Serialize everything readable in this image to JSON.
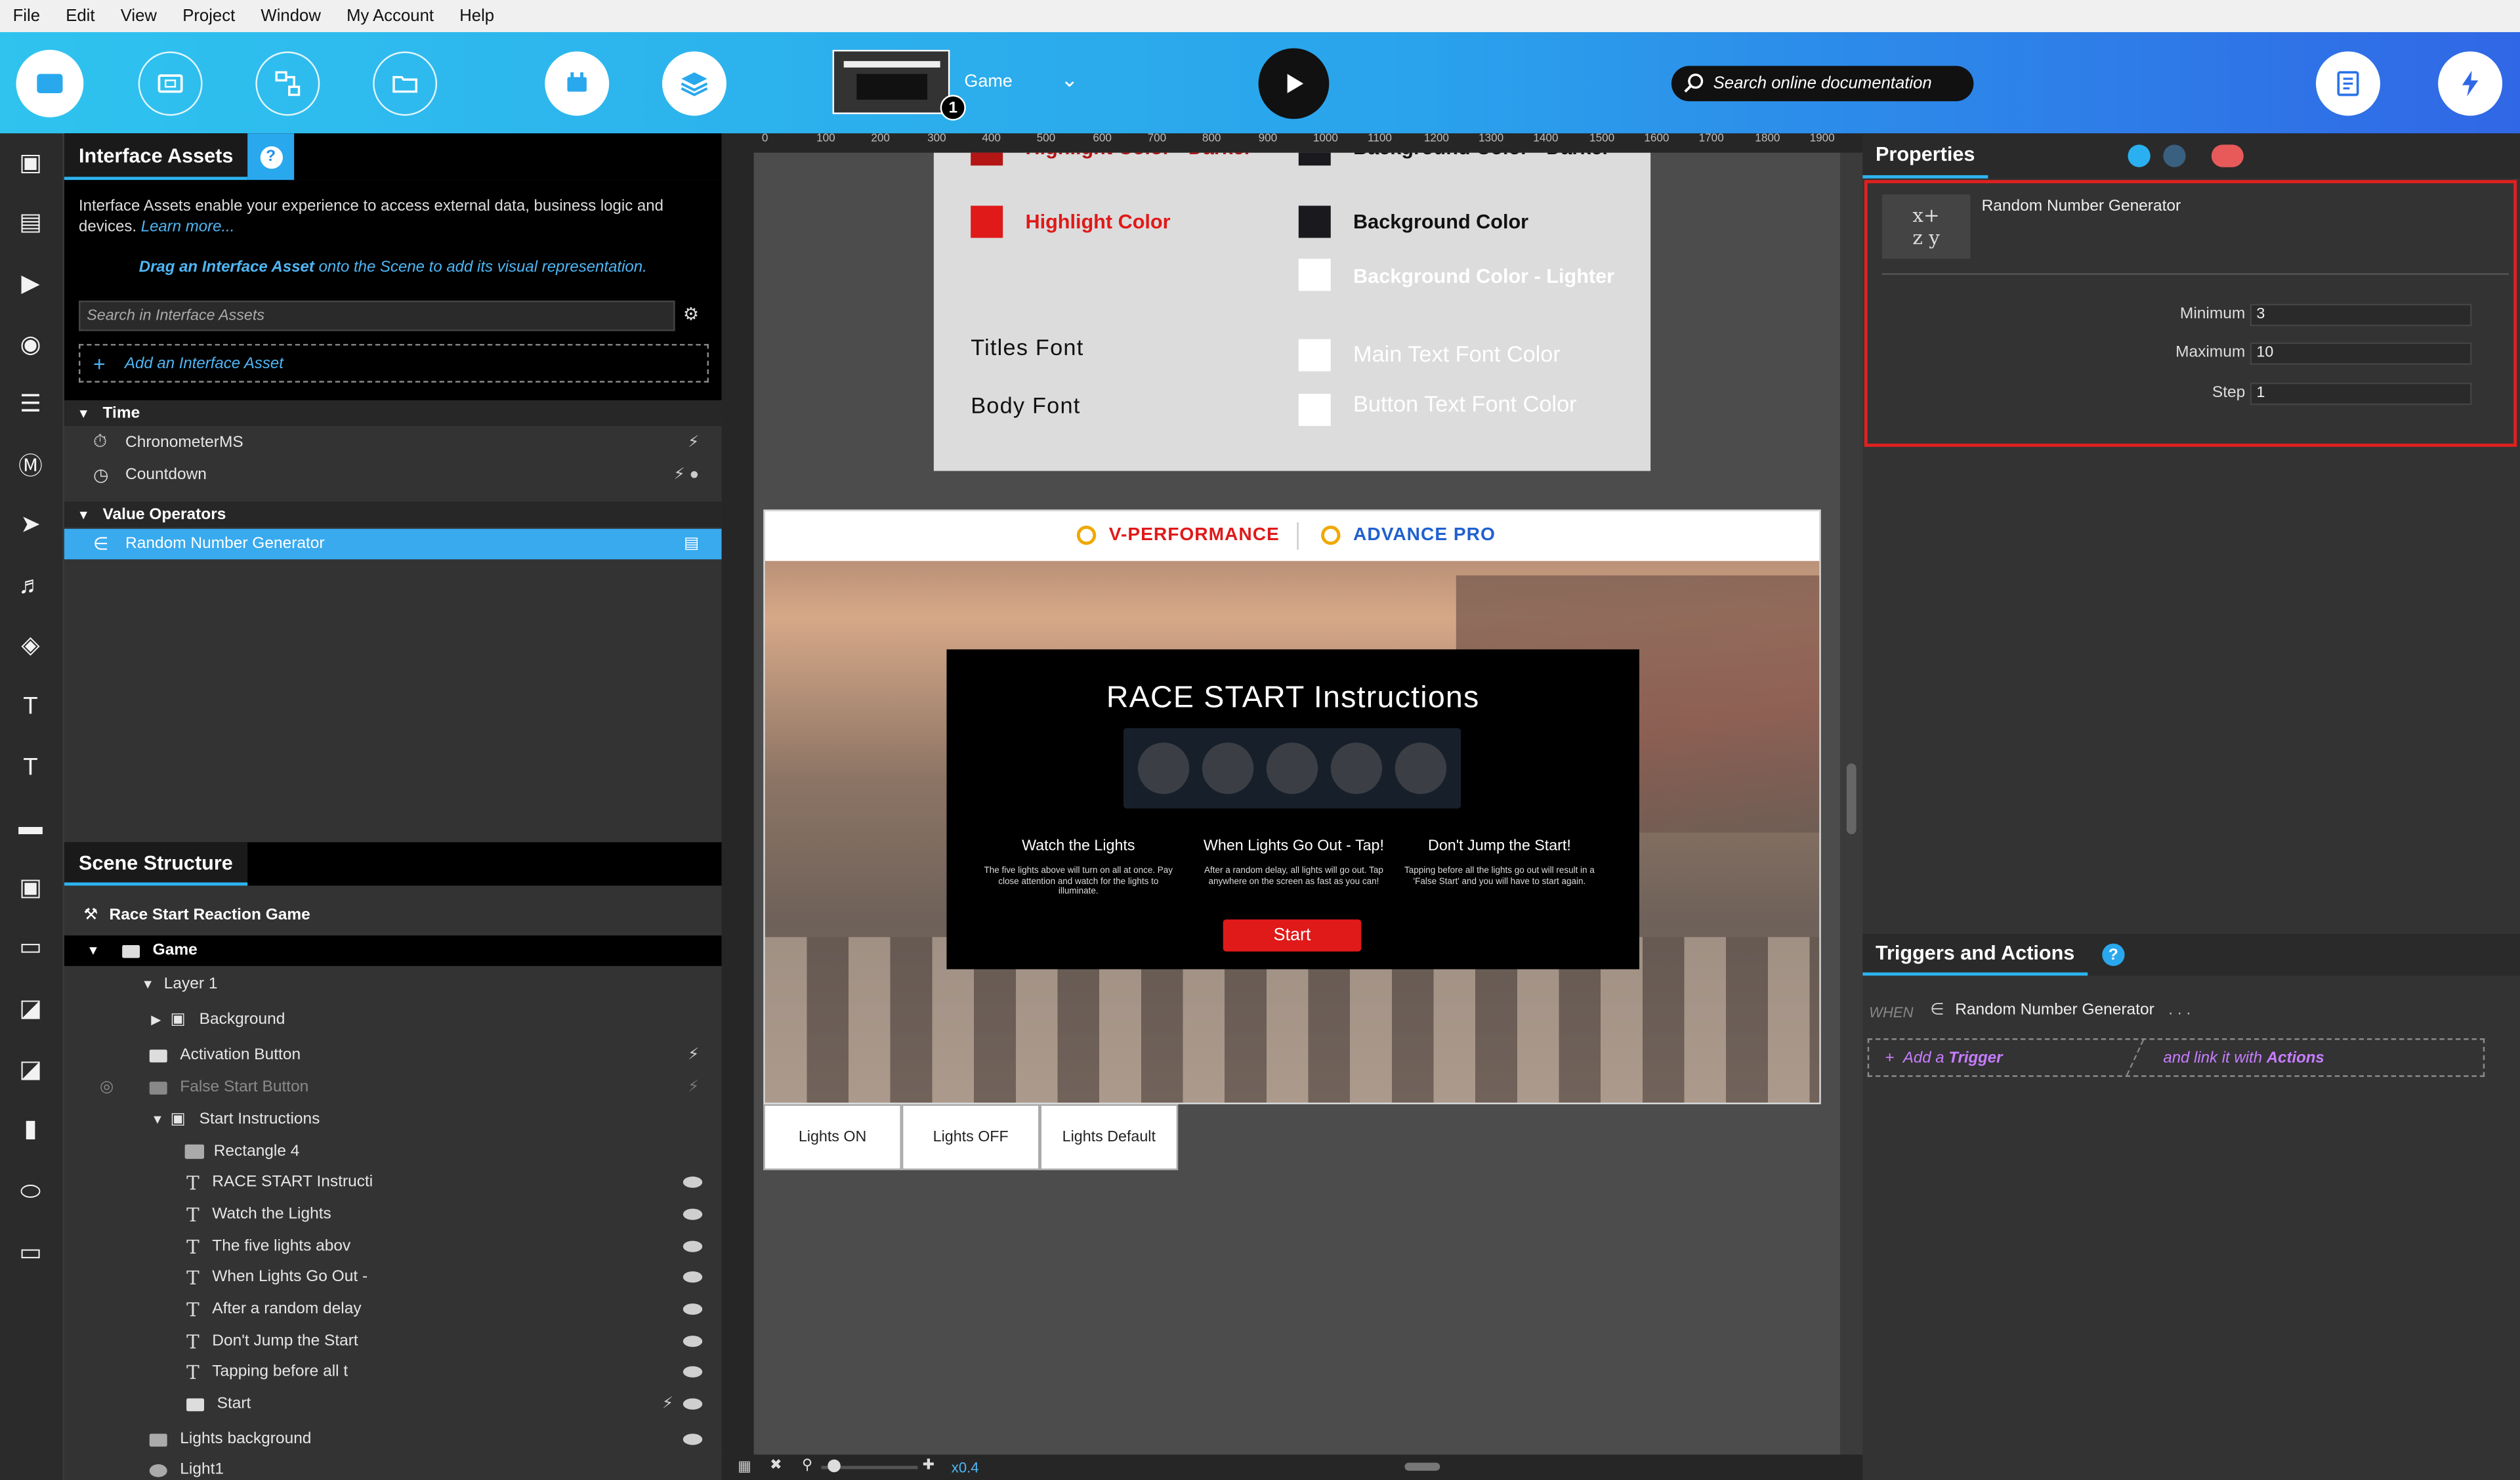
{
  "menu": [
    "File",
    "Edit",
    "View",
    "Project",
    "Window",
    "My Account",
    "Help"
  ],
  "toolbar": {
    "scene_name": "Game",
    "badge_count": "1",
    "search_placeholder": "Search online documentation"
  },
  "interface_assets": {
    "title": "Interface Assets",
    "help": "?",
    "description": "Interface Assets enable your experience to access external data, business logic and devices.",
    "learn_more": "Learn more...",
    "drag_prefix": "Drag an Interface Asset",
    "drag_suffix": "onto the Scene to add its visual representation.",
    "search_placeholder": "Search in Interface Assets",
    "add_label": "Add an Interface Asset",
    "sections": [
      {
        "title": "Time",
        "items": [
          "ChronometerMS",
          "Countdown"
        ]
      },
      {
        "title": "Value Operators",
        "items": [
          "Random Number Generator"
        ]
      }
    ]
  },
  "scene_structure": {
    "title": "Scene Structure",
    "root": "Race Start Reaction Game",
    "rows": [
      "Game",
      "Layer 1",
      "Background",
      "Activation Button",
      "False Start Button",
      "Start Instructions",
      "Rectangle 4",
      "RACE START Instructi",
      "Watch the Lights",
      "The five lights abov",
      "When Lights Go Out -",
      "After a random delay",
      "Don't Jump the Start",
      "Tapping before all t",
      "Start",
      "Lights background",
      "Light1"
    ]
  },
  "ruler": {
    "top": [
      "0",
      "100",
      "200",
      "300",
      "400",
      "500",
      "600",
      "700",
      "800",
      "900",
      "1000",
      "1100",
      "1200",
      "1300",
      "1400",
      "1500",
      "1600",
      "1700",
      "1800",
      "1900"
    ]
  },
  "canvas": {
    "colors": {
      "highlight_darker": "Highlight Color - Darker",
      "highlight": "Highlight Color",
      "bg_darker": "Background Color - Darker",
      "bg": "Background Color",
      "bg_lighter": "Background Color - Lighter",
      "titles_font": "Titles Font",
      "body_font": "Body Font",
      "main_text": "Main Text Font Color",
      "button_text": "Button Text Font Color",
      "red": "#e01919",
      "dark_red": "#b41515",
      "black": "#1a1a1e"
    },
    "brand1": "V-PERFORMANCE",
    "brand2": "ADVANCE PRO",
    "modal": {
      "title": "RACE START Instructions",
      "col1_title": "Watch the Lights",
      "col1_body": "The five lights above will turn on all at once. Pay close attention and watch for the lights to illuminate.",
      "col2_title": "When Lights Go Out - Tap!",
      "col2_body": "After a random delay, all lights will go out. Tap anywhere on the screen as fast as you can!",
      "col3_title": "Don't Jump the Start!",
      "col3_body": "Tapping before all the lights go out will result in a 'False Start' and you will have to start again.",
      "start_label": "Start"
    },
    "buttons": [
      "Lights ON",
      "Lights OFF",
      "Lights Default"
    ],
    "zoom": "x0.4"
  },
  "properties": {
    "title": "Properties",
    "component": "Random Number Generator",
    "fields": [
      {
        "label": "Minimum",
        "value": "3"
      },
      {
        "label": "Maximum",
        "value": "10"
      },
      {
        "label": "Step",
        "value": "1"
      }
    ]
  },
  "triggers": {
    "title": "Triggers and Actions",
    "when": "WHEN",
    "when_item": "Random Number Generator",
    "add_trigger_prefix": "Add a",
    "add_trigger_bold": "Trigger",
    "link_prefix": "and link it with",
    "link_bold": "Actions"
  }
}
